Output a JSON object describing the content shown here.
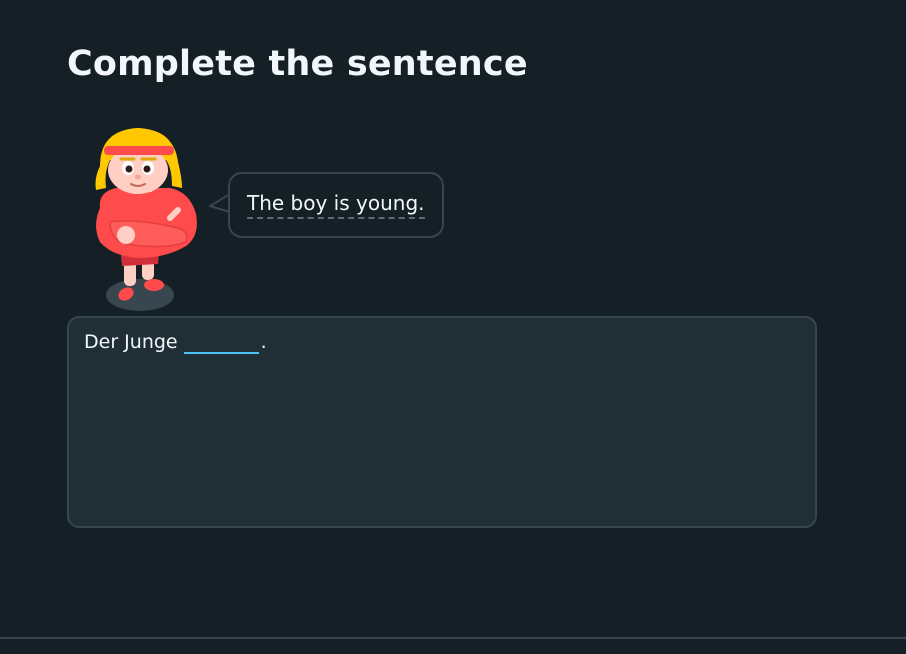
{
  "title": "Complete the sentence",
  "speech_bubble": {
    "text": "The boy is young."
  },
  "answer": {
    "prefix": "Der Junge",
    "blank_value": "",
    "suffix": "."
  },
  "character": {
    "icon": "cartoon-boy-character"
  },
  "colors": {
    "background": "#151f26",
    "box_background": "#202f36",
    "border": "#37464f",
    "blank_underline": "#49c0f8",
    "text": "#f1f7fb"
  }
}
